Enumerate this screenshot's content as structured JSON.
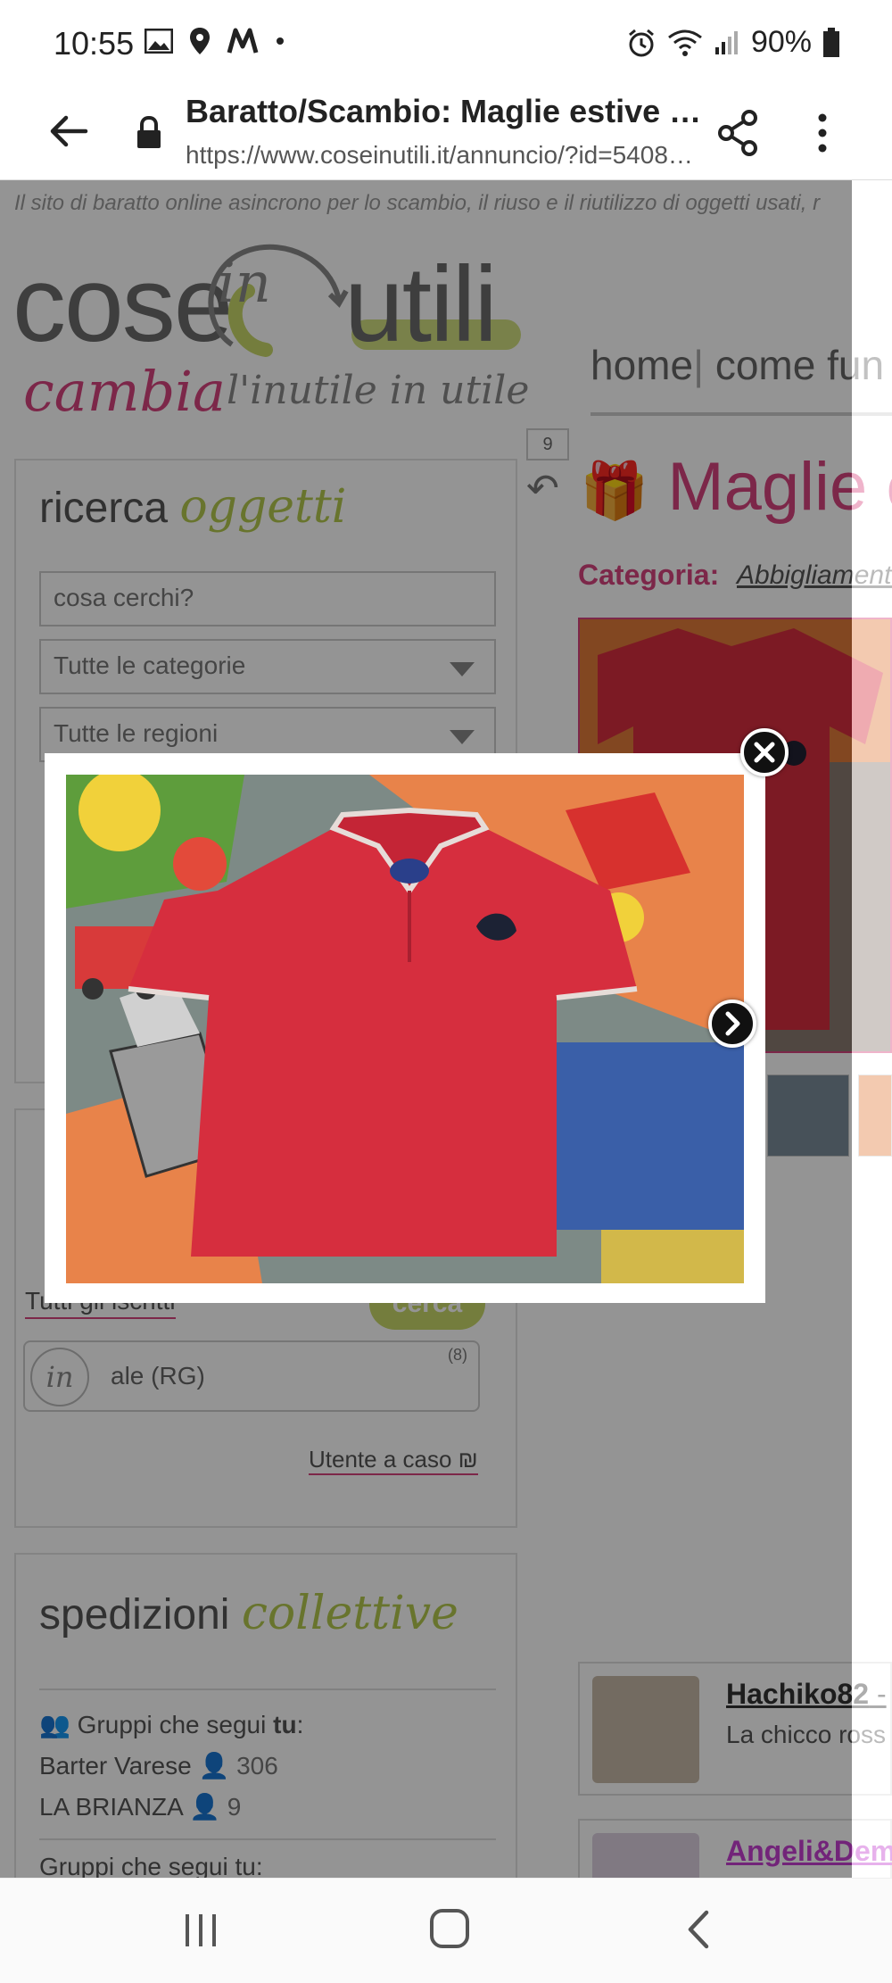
{
  "status_bar": {
    "time": "10:55",
    "battery": "90%"
  },
  "browser": {
    "page_title": "Baratto/Scambio: Maglie estive 1…",
    "url": "https://www.coseinutili.it/annuncio/?id=5408…"
  },
  "site": {
    "tagline": "Il sito di baratto online asincrono per lo scambio, il riuso e il riutilizzo di oggetti usati, r",
    "logo": {
      "word_left": "cose",
      "word_in": "in",
      "word_right": "utili",
      "word_cambia": "cambia",
      "slogan": "l'inutile in utile"
    }
  },
  "search_box": {
    "heading_plain": "ricerca ",
    "heading_script": "oggetti",
    "query_placeholder": "cosa cerchi?",
    "category_select": "Tutte le categorie",
    "region_select": "Tutte le regioni"
  },
  "users_box": {
    "all_users_link": "Tutti gli iscritti",
    "search_button": "cerca",
    "user_card": {
      "badge": "in",
      "name": "ale (RG)",
      "count": "(8)"
    },
    "random_user_link": "Utente a caso"
  },
  "shipping_box": {
    "heading_plain": "spedizioni ",
    "heading_script": "collettive",
    "groups_label_pre": "Gruppi che segui ",
    "groups_label_bold": "tu",
    "groups_label_post": ":",
    "groups": [
      {
        "name": "Barter Varese",
        "count": "306"
      },
      {
        "name": "LA BRIANZA",
        "count": "9"
      }
    ],
    "groups_label_2": "Gruppi che segui tu:"
  },
  "listing": {
    "nav_home": "home",
    "nav_sep": "|",
    "nav_how": "come fun",
    "undo_count": "9",
    "title": "Maglie e",
    "category_label": "Categoria:",
    "category_value": "Abbigliamento"
  },
  "comments": [
    {
      "user": "Hachiko82",
      "suffix": " -",
      "text": "La chicco ross"
    },
    {
      "user": "Angeli&Dem",
      "suffix": "",
      "text": ""
    }
  ],
  "colors": {
    "brand_pink": "#d6447e",
    "brand_green": "#c8d86a",
    "shirt_red": "#d62e3e"
  },
  "icons": {
    "close": "close-icon",
    "next": "chevron-right-icon"
  }
}
